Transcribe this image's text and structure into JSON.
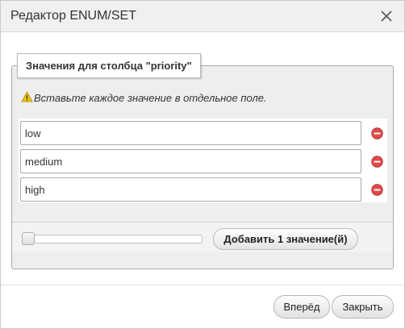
{
  "dialog": {
    "title": "Редактор ENUM/SET",
    "close_icon": "close-icon"
  },
  "fieldset": {
    "legend": "Значения для столбца \"priority\"",
    "warning_icon": "warning-icon",
    "warning_text": "Вставьте каждое значение в отдельное поле."
  },
  "values": [
    {
      "value": "low",
      "remove_icon": "remove-icon"
    },
    {
      "value": "medium",
      "remove_icon": "remove-icon"
    },
    {
      "value": "high",
      "remove_icon": "remove-icon"
    }
  ],
  "add_row": {
    "slider_value": 1,
    "button_label": "Добавить 1 значение(й)"
  },
  "footer": {
    "go_label": "Вперёд",
    "close_label": "Закрыть"
  },
  "colors": {
    "remove_icon": "#e04a4a",
    "warning_icon": "#f0c419"
  }
}
